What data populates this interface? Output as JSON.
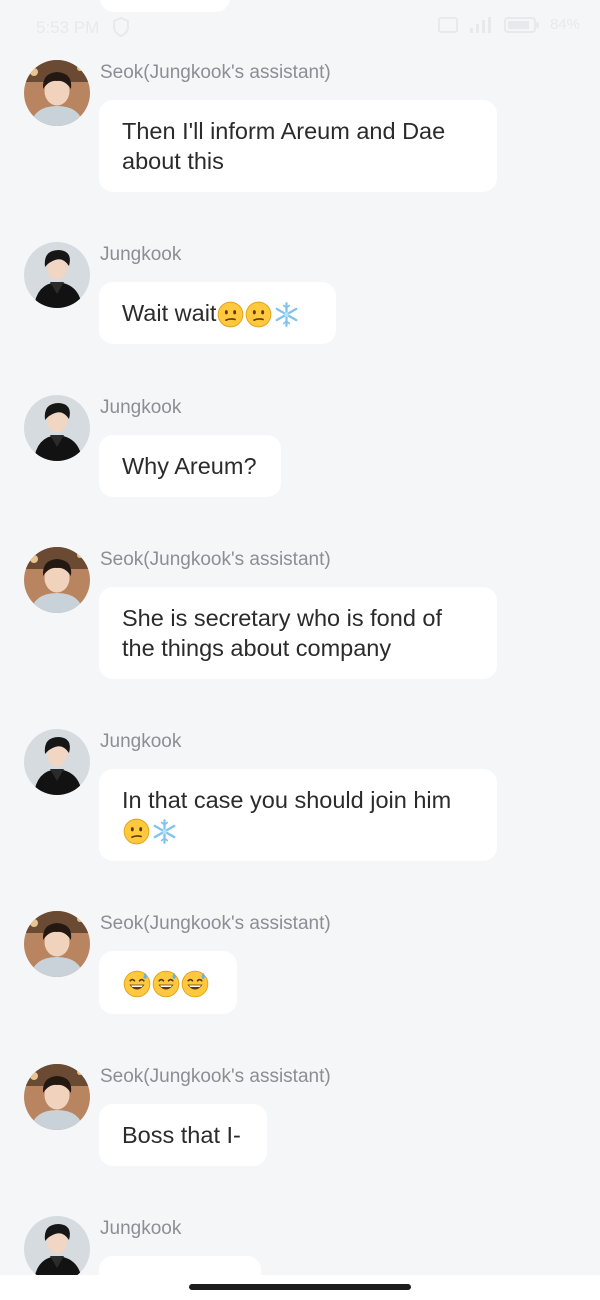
{
  "status_bar": {
    "time": "5:53 PM",
    "battery": "84%"
  },
  "messages": [
    {
      "sender": "Seok(Jungkook's assistant)",
      "text": "Then I'll inform Areum and Dae about this",
      "emojis": []
    },
    {
      "sender": "Jungkook",
      "text": "Wait wait",
      "emojis": [
        "confused-face",
        "confused-face",
        "snowflake"
      ]
    },
    {
      "sender": "Jungkook",
      "text": "Why Areum?",
      "emojis": []
    },
    {
      "sender": "Seok(Jungkook's assistant)",
      "text": "She is secretary who is fond of the things about company",
      "emojis": []
    },
    {
      "sender": "Jungkook",
      "text": "In that case you should join him",
      "emojis": [
        "confused-face",
        "snowflake"
      ]
    },
    {
      "sender": "Seok(Jungkook's assistant)",
      "text": "",
      "emojis": [
        "grinning-sweat-face",
        "grinning-sweat-face",
        "grinning-sweat-face"
      ]
    },
    {
      "sender": "Seok(Jungkook's assistant)",
      "text": "Boss that I-",
      "emojis": []
    },
    {
      "sender": "Jungkook",
      "text": "",
      "emojis": []
    }
  ],
  "colors": {
    "background": "#f5f6f8",
    "bubble": "#ffffff",
    "sender_name": "#8b8e94",
    "message_text": "#2b2b2b"
  }
}
